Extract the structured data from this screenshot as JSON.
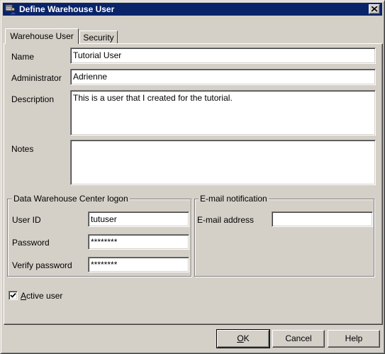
{
  "window": {
    "title": "Define Warehouse User",
    "title_icon": "warehouse-user-icon",
    "close_icon": "close-icon"
  },
  "tabs": [
    {
      "label": "Warehouse User",
      "active": true
    },
    {
      "label": "Security",
      "active": false
    }
  ],
  "form": {
    "name": {
      "label": "Name",
      "value": "Tutorial User"
    },
    "administrator": {
      "label": "Administrator",
      "value": "Adrienne"
    },
    "description": {
      "label": "Description",
      "value": "This is a user that I created for the tutorial."
    },
    "notes": {
      "label": "Notes",
      "value": ""
    }
  },
  "logon_group": {
    "title": "Data Warehouse Center logon",
    "user_id": {
      "label": "User ID",
      "value": "tutuser"
    },
    "password": {
      "label": "Password",
      "value": "********"
    },
    "verify_password": {
      "label": "Verify password",
      "value": "********"
    }
  },
  "email_group": {
    "title": "E-mail notification",
    "email": {
      "label": "E-mail address",
      "value": ""
    }
  },
  "active_user": {
    "label_prefix": "A",
    "label_rest": "ctive user",
    "checked": true
  },
  "buttons": {
    "ok_prefix": "O",
    "ok_rest": "K",
    "cancel": "Cancel",
    "help": "Help"
  },
  "colors": {
    "title_bar": "#0a246a",
    "face": "#d4d0c8"
  }
}
